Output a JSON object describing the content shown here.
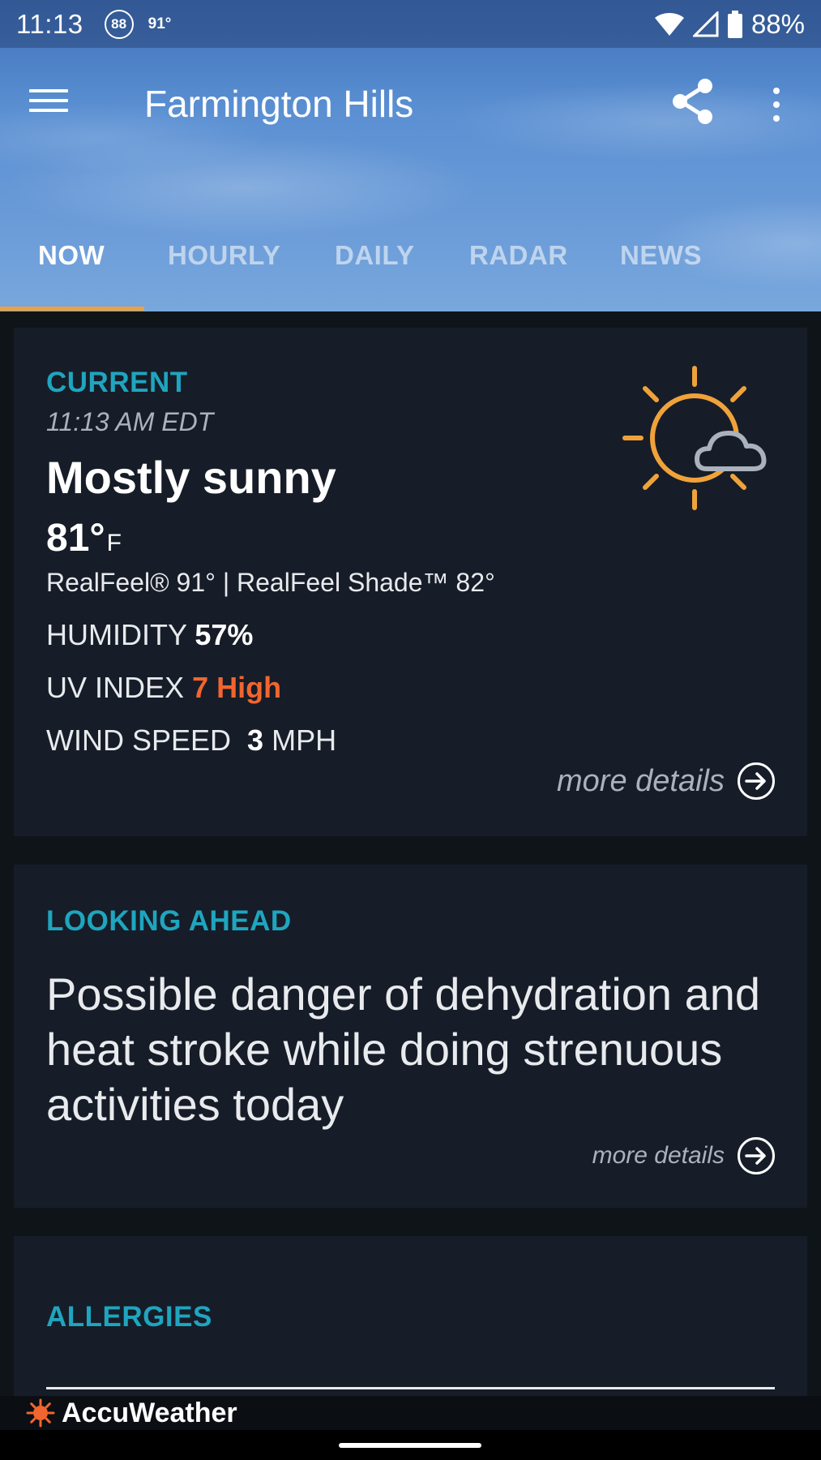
{
  "status_bar": {
    "time": "11:13",
    "circle_badge": "88",
    "temp": "91°",
    "battery": "88%"
  },
  "app_bar": {
    "title": "Farmington Hills"
  },
  "tabs": [
    {
      "label": "NOW",
      "active": true
    },
    {
      "label": "HOURLY",
      "active": false
    },
    {
      "label": "DAILY",
      "active": false
    },
    {
      "label": "RADAR",
      "active": false
    },
    {
      "label": "NEWS",
      "active": false
    }
  ],
  "current": {
    "section_label": "CURRENT",
    "time": "11:13 AM EDT",
    "condition": "Mostly sunny",
    "temp_value": "81°",
    "temp_unit": "F",
    "realfeel": "RealFeel® 91° | RealFeel Shade™ 82°",
    "humidity_label": "HUMIDITY",
    "humidity_value": "57%",
    "uv_label": "UV INDEX",
    "uv_value": "7 High",
    "wind_label": "WIND SPEED",
    "wind_value": "3",
    "wind_unit": "MPH",
    "more_details": "more details",
    "icon": "mostly-sunny-icon"
  },
  "looking_ahead": {
    "section_label": "LOOKING AHEAD",
    "text": "Possible danger of dehydration and heat stroke while doing strenuous activities today",
    "more_details": "more details"
  },
  "allergies": {
    "section_label": "ALLERGIES"
  },
  "brand": {
    "name": "AccuWeather"
  },
  "colors": {
    "accent_cyan": "#1fa5bf",
    "uv_orange": "#f2652e",
    "sun_orange": "#f0a23a",
    "card_bg": "#161d28"
  }
}
